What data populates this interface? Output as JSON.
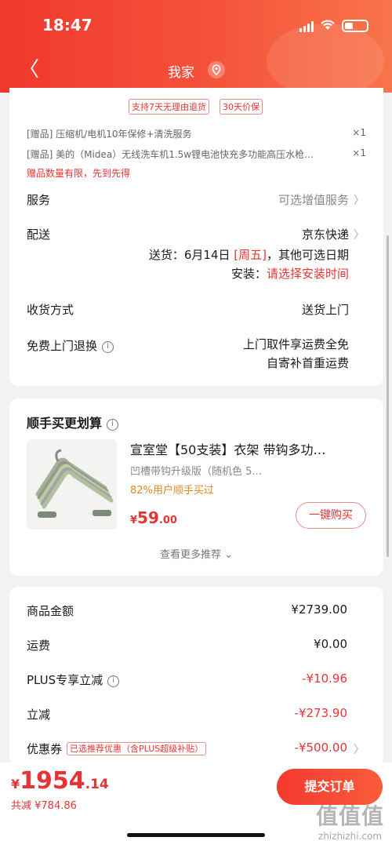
{
  "status_bar": {
    "time": "18:47"
  },
  "nav": {
    "back_glyph": "〈",
    "title": "我家",
    "location_icon": "location-pin-icon"
  },
  "service_tags": [
    "支持7天无理由退货",
    "30天价保"
  ],
  "gifts": [
    {
      "text": "[赠品] 压缩机/电机10年保修+清洗服务",
      "qty": "×1"
    },
    {
      "text": "[赠品] 美的（Midea）无线洗车机1.5w锂电池快充多功能高压水枪…",
      "qty": "×1"
    }
  ],
  "gift_note": "赠品数量有限，先到先得",
  "service": {
    "label": "服务",
    "value": "可选增值服务"
  },
  "delivery": {
    "label": "配送",
    "carrier": "京东快递",
    "date_prefix": "送货：6月14日 ",
    "date_weekday": "[周五]",
    "date_suffix": "，其他可选日期",
    "install_prefix": "安装：",
    "install_value": "请选择安装时间"
  },
  "receive": {
    "label": "收货方式",
    "value": "送货上门"
  },
  "return_service": {
    "label": "免费上门退换",
    "value_line1": "上门取件享运费全免",
    "value_line2": "自寄补首重运费"
  },
  "recommend": {
    "title": "顺手买更划算",
    "product": {
      "title": "宣室堂【50支装】衣架 带钩多功…",
      "subtitle": "凹槽带钩升级版（随机色 5...",
      "percent": "82%用户顺手买过",
      "price_currency": "¥",
      "price_int": "59",
      "price_dec": ".00",
      "button": "一键购买"
    },
    "more": "查看更多推荐 ⌄"
  },
  "summary": {
    "rows": [
      {
        "label": "商品金额",
        "value": "¥2739.00"
      },
      {
        "label": "运费",
        "value": "¥0.00"
      },
      {
        "label": "PLUS专享立减",
        "value": "-¥10.96"
      },
      {
        "label": "立减",
        "value": "-¥273.90"
      },
      {
        "label": "优惠券",
        "value": "-¥500.00"
      }
    ],
    "coupon_tag": "已选推荐优惠（含PLUS超级补贴）"
  },
  "bottom_bar": {
    "currency": "¥",
    "total_int": "1954",
    "total_dec": ".14",
    "discount": "共减 ¥784.86",
    "submit": "提交订单"
  },
  "watermark": {
    "logo": "值值值",
    "url": "zhizhizhi.com"
  },
  "colors": {
    "accent": "#e63434",
    "header": "#f0382e",
    "orange_text": "#d98b2a"
  }
}
